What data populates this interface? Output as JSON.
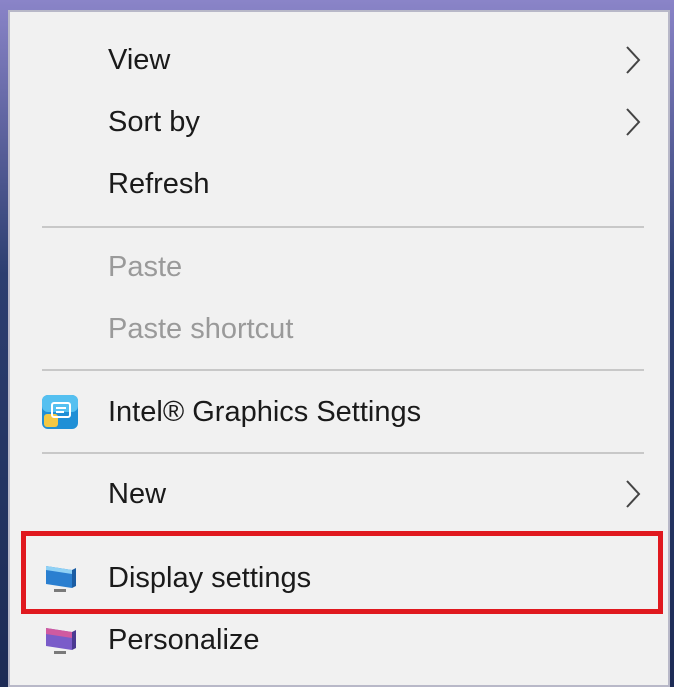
{
  "context_menu": {
    "items": [
      {
        "id": "view",
        "label": "View",
        "has_submenu": true,
        "disabled": false,
        "icon": null
      },
      {
        "id": "sort-by",
        "label": "Sort by",
        "has_submenu": true,
        "disabled": false,
        "icon": null
      },
      {
        "id": "refresh",
        "label": "Refresh",
        "has_submenu": false,
        "disabled": false,
        "icon": null
      },
      {
        "id": "paste",
        "label": "Paste",
        "has_submenu": false,
        "disabled": true,
        "icon": null
      },
      {
        "id": "paste-shortcut",
        "label": "Paste shortcut",
        "has_submenu": false,
        "disabled": true,
        "icon": null
      },
      {
        "id": "intel-graphics",
        "label": "Intel® Graphics Settings",
        "has_submenu": false,
        "disabled": false,
        "icon": "intel-graphics-icon"
      },
      {
        "id": "new",
        "label": "New",
        "has_submenu": true,
        "disabled": false,
        "icon": null
      },
      {
        "id": "display-settings",
        "label": "Display settings",
        "has_submenu": false,
        "disabled": false,
        "icon": "display-monitor-icon",
        "highlighted": true
      },
      {
        "id": "personalize",
        "label": "Personalize",
        "has_submenu": false,
        "disabled": false,
        "icon": "personalize-monitor-icon"
      }
    ]
  },
  "colors": {
    "menu_background": "#f1f1f1",
    "highlight_border": "#e0191f",
    "disabled_text": "#9a9a9a",
    "text": "#1a1a1a"
  }
}
